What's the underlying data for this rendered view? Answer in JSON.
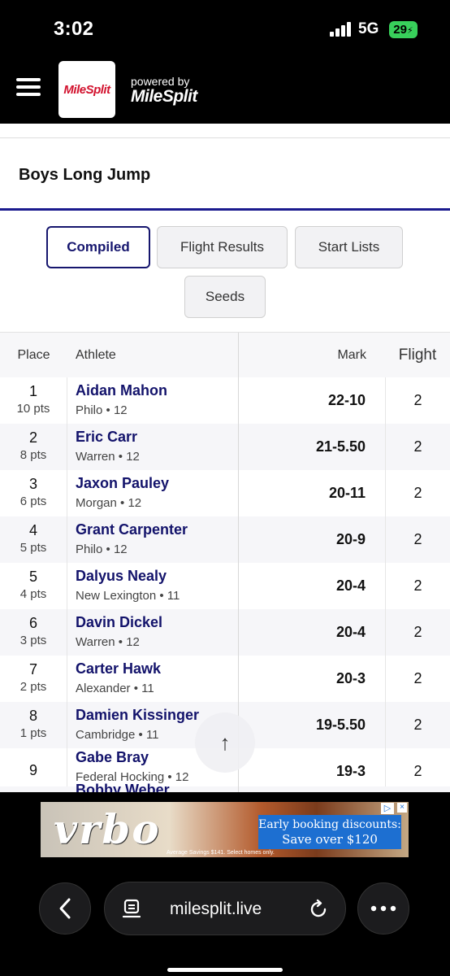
{
  "status_bar": {
    "time": "3:02",
    "network": "5G",
    "battery": "29"
  },
  "header": {
    "logo_text": "MileSplit",
    "powered_by": "powered by",
    "powered_brand": "MileSplit"
  },
  "event": {
    "title": "Boys Long Jump"
  },
  "tabs": [
    {
      "label": "Compiled",
      "active": true
    },
    {
      "label": "Flight Results",
      "active": false
    },
    {
      "label": "Start Lists",
      "active": false
    },
    {
      "label": "Seeds",
      "active": false
    }
  ],
  "table": {
    "headers": {
      "place": "Place",
      "athlete": "Athlete",
      "mark": "Mark",
      "flight": "Flight"
    },
    "rows": [
      {
        "place": "1",
        "pts": "10 pts",
        "name": "Aidan Mahon",
        "team": "Philo • 12",
        "mark": "22-10",
        "flight": "2"
      },
      {
        "place": "2",
        "pts": "8 pts",
        "name": "Eric Carr",
        "team": "Warren • 12",
        "mark": "21-5.50",
        "flight": "2"
      },
      {
        "place": "3",
        "pts": "6 pts",
        "name": "Jaxon Pauley",
        "team": "Morgan • 12",
        "mark": "20-11",
        "flight": "2"
      },
      {
        "place": "4",
        "pts": "5 pts",
        "name": "Grant Carpenter",
        "team": "Philo • 12",
        "mark": "20-9",
        "flight": "2"
      },
      {
        "place": "5",
        "pts": "4 pts",
        "name": "Dalyus Nealy",
        "team": "New Lexington • 11",
        "mark": "20-4",
        "flight": "2"
      },
      {
        "place": "6",
        "pts": "3 pts",
        "name": "Davin Dickel",
        "team": "Warren • 12",
        "mark": "20-4",
        "flight": "2"
      },
      {
        "place": "7",
        "pts": "2 pts",
        "name": "Carter Hawk",
        "team": "Alexander • 11",
        "mark": "20-3",
        "flight": "2"
      },
      {
        "place": "8",
        "pts": "1 pts",
        "name": "Damien Kissinger",
        "team": "Cambridge • 11",
        "mark": "19-5.50",
        "flight": "2"
      },
      {
        "place": "9",
        "pts": "",
        "name": "Gabe Bray",
        "team": "Federal Hocking • 12",
        "mark": "19-3",
        "flight": "2"
      },
      {
        "place": "",
        "pts": "",
        "name": "Bobby Weber",
        "team": "",
        "mark": "",
        "flight": ""
      }
    ]
  },
  "ad": {
    "brand": "vrbo",
    "headline": "Early booking discounts:",
    "subline": "Save over $120",
    "note": "Average Savings $141. Select homes only.",
    "info": "▷",
    "close": "×"
  },
  "browser": {
    "url": "milesplit.live",
    "back_icon": "chevron-left-icon",
    "more_icon": "ellipsis-icon"
  },
  "scroll_top": {
    "icon": "arrow-up-icon"
  }
}
